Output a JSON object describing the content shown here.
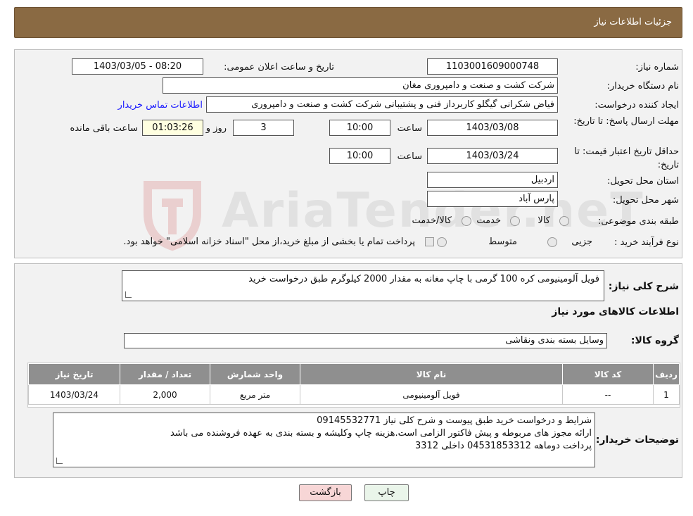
{
  "header": {
    "title": "جزئیات اطلاعات نیاز"
  },
  "details": {
    "need_number_label": "شماره نیاز:",
    "need_number": "1103001609000748",
    "announce_label": "تاریخ و ساعت اعلان عمومی:",
    "announce_value": "1403/03/05 - 08:20",
    "buyer_org_label": "نام دستگاه خریدار:",
    "buyer_org": "شرکت کشت و صنعت و دامپروری مغان",
    "creator_label": "ایجاد کننده درخواست:",
    "creator": "فیاض شکرانی گیگلو کاربرداز فنی و پشتیبانی شرکت کشت و صنعت و دامپروری",
    "contact_link": "اطلاعات تماس خریدار",
    "reply_deadline_label": "مهلت ارسال پاسخ: تا تاریخ:",
    "reply_date": "1403/03/08",
    "time_label": "ساعت",
    "reply_time": "10:00",
    "days_value": "3",
    "days_label": "روز و",
    "remaining_time": "01:03:26",
    "remaining_label": "ساعت باقی مانده",
    "price_validity_label": "حداقل تاریخ اعتبار قیمت: تا تاریخ:",
    "price_date": "1403/03/24",
    "price_time": "10:00",
    "province_label": "استان محل تحویل:",
    "province": "اردبیل",
    "city_label": "شهر محل تحویل:",
    "city": "پارس آباد",
    "category_label": "طبقه بندی موضوعی:",
    "category_options": [
      "کالا",
      "خدمت",
      "کالا/خدمت"
    ],
    "purchase_type_label": "نوع فرآیند خرید :",
    "purchase_options": [
      "جزیی",
      "متوسط"
    ],
    "purchase_note": "پرداخت تمام یا بخشی از مبلغ خرید،از محل \"اسناد خزانه اسلامی\" خواهد بود."
  },
  "watermark": {
    "text": "AriaTender.neT"
  },
  "summary": {
    "label": "شرح کلی نیاز:",
    "text": "فویل آلومینیومی کره 100 گرمی با چاپ مغانه به مقدار 2000 کیلوگرم طبق درخواست خرید",
    "items_heading": "اطلاعات کالاهای مورد نیاز",
    "group_label": "گروه کالا:",
    "group_value": "وسایل بسته بندی  ونقاشی"
  },
  "table": {
    "headers": [
      "ردیف",
      "کد کالا",
      "نام کالا",
      "واحد شمارش",
      "تعداد / مقدار",
      "تاریخ نیاز"
    ],
    "rows": [
      [
        "1",
        "--",
        "فویل آلومینیومی",
        "متر مربع",
        "2,000",
        "1403/03/24"
      ]
    ]
  },
  "buyer_notes": {
    "label": "توضیحات خریدار:",
    "lines": [
      "شرایط و درخواست خرید طبق پیوست و شرح کلی نیاز 09145532771",
      "ارائه مجوز های مربوطه و پیش فاکتور الزامی است.هزینه چاپ وکلیشه و بسته بندی به عهده فروشنده می باشد",
      "پرداخت دوماهه 04531853312 داخلی  3312"
    ]
  },
  "buttons": {
    "print": "چاپ",
    "back": "بازگشت"
  },
  "colors": {
    "header": "#8a6a43",
    "back_button": "#f7d6d6",
    "print_button": "#eaf5ea",
    "link": "#1a1aff"
  }
}
